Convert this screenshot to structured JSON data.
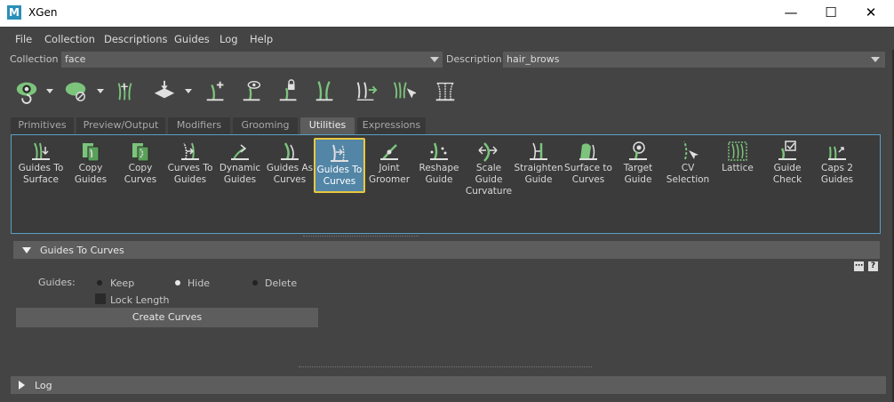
{
  "window": {
    "app_icon": "M",
    "title": "XGen",
    "minimize": "—",
    "maximize": "☐",
    "close": "✕"
  },
  "menu": [
    "File",
    "Collection",
    "Descriptions",
    "Guides",
    "Log",
    "Help"
  ],
  "collection": {
    "label": "Collection",
    "value": "face"
  },
  "description": {
    "label": "Description",
    "value": "hair_brows"
  },
  "toolbar_icons": [
    "preview-eye-icon",
    "clear-preview-icon",
    "sculpt-guides-icon",
    "move-guides-icon",
    "add-guide-icon",
    "toggle-visibility-icon",
    "lock-guide-icon",
    "select-guide-cvs-icon",
    "flip-guides-icon",
    "rebuild-guides-icon",
    "normalize-guides-icon"
  ],
  "tabs": [
    {
      "label": "Primitives",
      "active": false
    },
    {
      "label": "Preview/Output",
      "active": false
    },
    {
      "label": "Modifiers",
      "active": false
    },
    {
      "label": "Grooming",
      "active": false
    },
    {
      "label": "Utilities",
      "active": true
    },
    {
      "label": "Expressions",
      "active": false
    }
  ],
  "tools": [
    {
      "label1": "Guides To",
      "label2": "Surface",
      "label3": "",
      "icon": "guides-to-surface-icon",
      "selected": false
    },
    {
      "label1": "Copy",
      "label2": "Guides",
      "label3": "",
      "icon": "copy-guides-icon",
      "selected": false
    },
    {
      "label1": "Copy",
      "label2": "Curves",
      "label3": "",
      "icon": "copy-curves-icon",
      "selected": false
    },
    {
      "label1": "Curves To",
      "label2": "Guides",
      "label3": "",
      "icon": "curves-to-guides-icon",
      "selected": false
    },
    {
      "label1": "Dynamic",
      "label2": "Guides",
      "label3": "",
      "icon": "dynamic-guides-icon",
      "selected": false
    },
    {
      "label1": "Guides As",
      "label2": "Curves",
      "label3": "",
      "icon": "guides-as-curves-icon",
      "selected": false
    },
    {
      "label1": "Guides To",
      "label2": "Curves",
      "label3": "",
      "icon": "guides-to-curves-icon",
      "selected": true
    },
    {
      "label1": "Joint",
      "label2": "Groomer",
      "label3": "",
      "icon": "joint-groomer-icon",
      "selected": false
    },
    {
      "label1": "Reshape",
      "label2": "Guide",
      "label3": "",
      "icon": "reshape-guide-icon",
      "selected": false
    },
    {
      "label1": "Scale",
      "label2": "Guide",
      "label3": "Curvature",
      "icon": "scale-guide-curvature-icon",
      "selected": false
    },
    {
      "label1": "Straighten",
      "label2": "Guide",
      "label3": "",
      "icon": "straighten-guide-icon",
      "selected": false
    },
    {
      "label1": "Surface to",
      "label2": "Curves",
      "label3": "",
      "icon": "surface-to-curves-icon",
      "selected": false
    },
    {
      "label1": "Target",
      "label2": "Guide",
      "label3": "",
      "icon": "target-guide-icon",
      "selected": false
    },
    {
      "label1": "CV",
      "label2": "Selection",
      "label3": "",
      "icon": "cv-selection-icon",
      "selected": false
    },
    {
      "label1": "Lattice",
      "label2": "",
      "label3": "",
      "icon": "lattice-icon",
      "selected": false
    },
    {
      "label1": "Guide",
      "label2": "Check",
      "label3": "",
      "icon": "guide-check-icon",
      "selected": false
    },
    {
      "label1": "Caps 2",
      "label2": "Guides",
      "label3": "",
      "icon": "caps-2-guides-icon",
      "selected": false
    }
  ],
  "section": {
    "title": "Guides To Curves",
    "mini_buttons": [
      "⋯",
      "?"
    ],
    "guides_label": "Guides:",
    "options": [
      {
        "label": "Keep",
        "selected": false
      },
      {
        "label": "Hide",
        "selected": true
      },
      {
        "label": "Delete",
        "selected": false
      }
    ],
    "lock_length_label": "Lock Length",
    "lock_length_checked": false,
    "create_button": "Create Curves"
  },
  "log": {
    "title": "Log"
  },
  "colors": {
    "accent_green": "#7cc47c",
    "selection_blue": "#5285a6",
    "selection_border": "#e8c840",
    "panel_border": "#5a9fc4"
  }
}
